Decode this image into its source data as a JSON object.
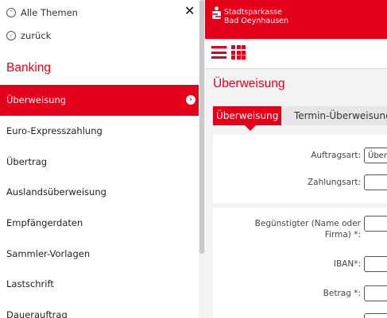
{
  "menu": {
    "top_links": [
      {
        "icon": "chevron-up-icon",
        "label": "Alle Themen"
      },
      {
        "icon": "chevron-left-icon",
        "label": "zurück"
      }
    ],
    "close_icon": "close-icon",
    "heading": "Banking",
    "items": [
      {
        "label": "Überweisung",
        "active": true
      },
      {
        "label": "Euro-Expresszahlung"
      },
      {
        "label": "Übertrag"
      },
      {
        "label": "Auslandsüberweisung"
      },
      {
        "label": "Empfängerdaten"
      },
      {
        "label": "Sammler-Vorlagen"
      },
      {
        "label": "Lastschrift"
      },
      {
        "label": "Dauerauftrag"
      }
    ]
  },
  "brand": {
    "line1": "Stadtsparkasse",
    "line2": "Bad Oeynhausen",
    "color": "#e2001a"
  },
  "toolbar": {
    "menu_icon": "hamburger-icon",
    "apps_icon": "grid-icon"
  },
  "main": {
    "title": "Überweisung",
    "tabs": [
      {
        "label": "Überweisung",
        "active": true
      },
      {
        "label": "Termin-Überweisung"
      }
    ],
    "section1": [
      {
        "label": "Auftragsart:",
        "value": "Überweisung"
      },
      {
        "label": "Zahlungsart:",
        "value": ""
      }
    ],
    "section2": [
      {
        "label_line1": "Begünstigter (Name oder",
        "label_line2": "Firma) *:",
        "value": ""
      },
      {
        "label": "IBAN*:",
        "value": ""
      },
      {
        "label": "Betrag *:",
        "value": ""
      }
    ]
  }
}
